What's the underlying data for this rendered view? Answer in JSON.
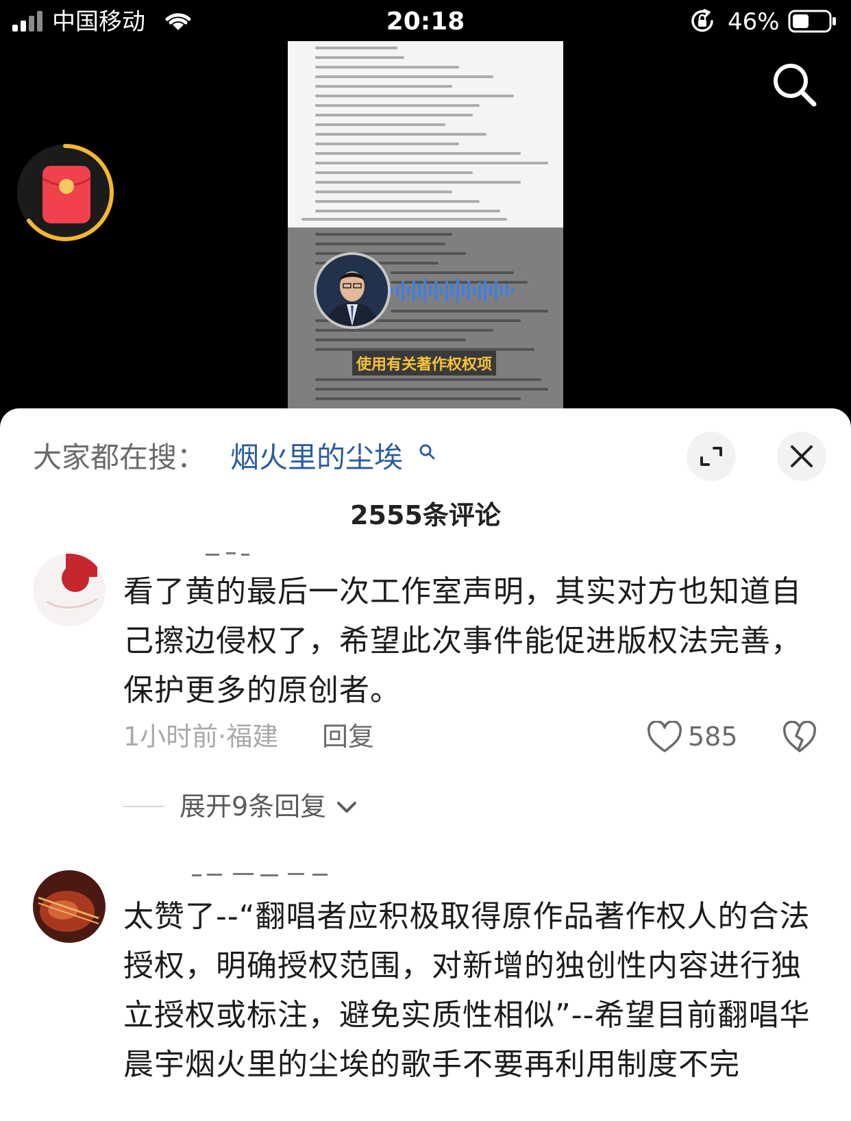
{
  "status_bar": {
    "carrier": "中国移动",
    "time": "20:18",
    "battery_percent": "46%",
    "battery_level": 0.46
  },
  "video": {
    "subtitle": "使用有关著作权权项"
  },
  "comment_sheet": {
    "hot_search_label": "大家都在搜：",
    "hot_search_term": "烟火里的尘埃",
    "comment_count": "2555条评论",
    "comments": [
      {
        "text": "看了黄的最后一次工作室声明，其实对方也知道自己擦边侵权了，希望此次事件能促进版权法完善，保护更多的原创者。",
        "meta": "1小时前·福建",
        "reply_label": "回复",
        "like_count": "585",
        "expand_replies": "展开9条回复"
      },
      {
        "text": "太赞了--“翻唱者应积极取得原作品著作权人的合法授权，明确授权范围，对新增的独创性内容进行独立授权或标注，避免实质性相似”--希望目前翻唱华晨宇烟火里的尘埃的歌手不要再利用制度不完"
      }
    ]
  },
  "icons": {
    "search": "search-icon",
    "red_packet": "red-packet-icon",
    "expand": "expand-icon",
    "close": "close-icon",
    "like": "heart-icon",
    "dislike": "broken-heart-icon"
  },
  "colors": {
    "hot_search_term": "#2b5d9c",
    "subtitle": "#f5c33b",
    "red_packet": "#f0414c",
    "ring": "#f5b731"
  }
}
